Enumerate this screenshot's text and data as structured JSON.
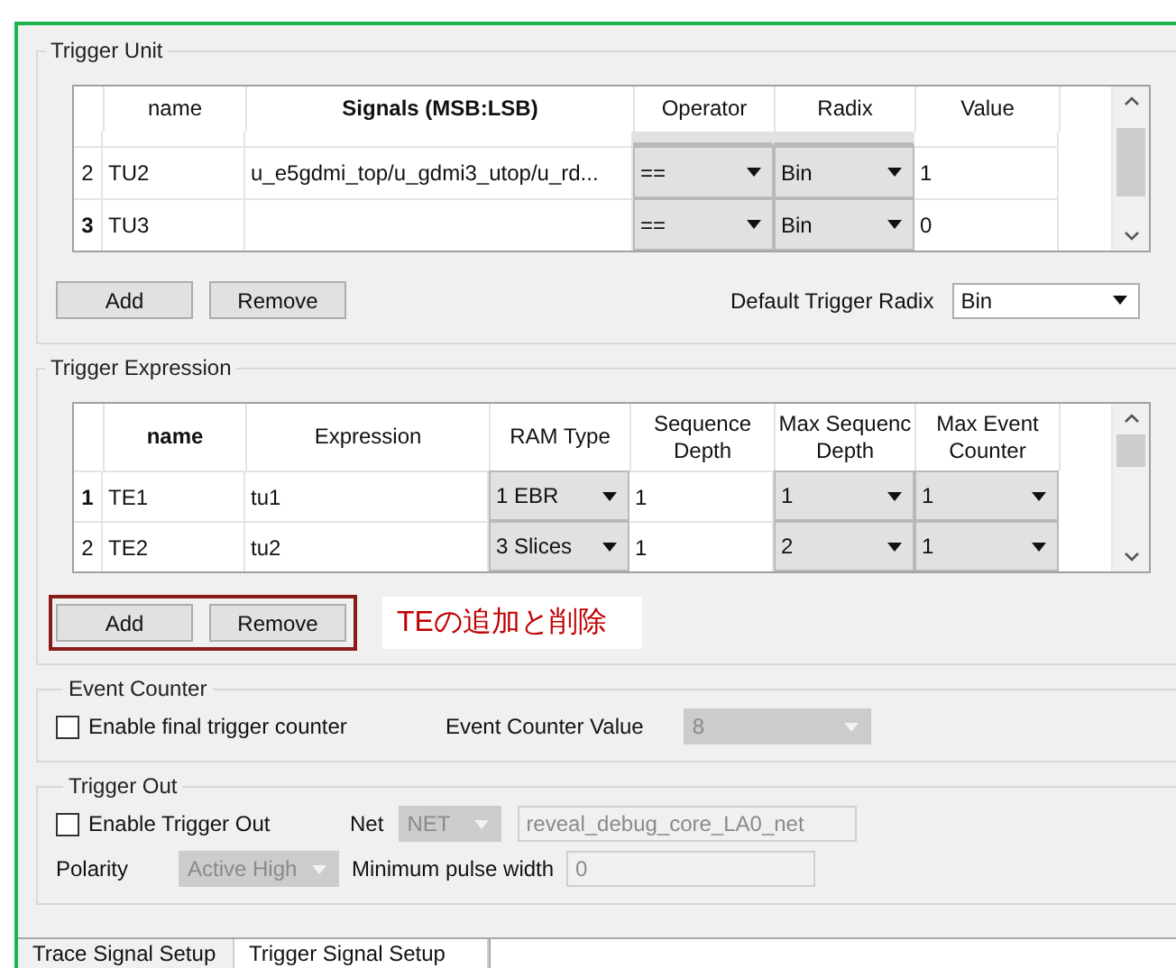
{
  "trigger_unit": {
    "title": "Trigger Unit",
    "table": {
      "columns": [
        {
          "label": "name",
          "bold": false
        },
        {
          "label": "Signals (MSB:LSB)",
          "bold": true
        },
        {
          "label": "Operator",
          "bold": false
        },
        {
          "label": "Radix",
          "bold": false
        },
        {
          "label": "Value",
          "bold": false
        }
      ],
      "rows": [
        {
          "number": "2",
          "selected": false,
          "cells": [
            {
              "kind": "text",
              "text": "TU2"
            },
            {
              "kind": "text",
              "text": "u_e5gdmi_top/u_gdmi3_utop/u_rd..."
            },
            {
              "kind": "select",
              "text": "=="
            },
            {
              "kind": "select",
              "text": "Bin"
            },
            {
              "kind": "text",
              "text": "1"
            }
          ]
        },
        {
          "number": "3",
          "selected": true,
          "cells": [
            {
              "kind": "text",
              "text": "TU3"
            },
            {
              "kind": "text",
              "text": ""
            },
            {
              "kind": "select",
              "text": "=="
            },
            {
              "kind": "select",
              "text": "Bin"
            },
            {
              "kind": "text",
              "text": "0"
            }
          ]
        }
      ]
    },
    "buttons": [
      "Add",
      "Remove"
    ],
    "default_radix": {
      "label": "Default Trigger Radix",
      "value": "Bin"
    }
  },
  "trigger_expression": {
    "title": "Trigger Expression",
    "table": {
      "columns": [
        {
          "label": "name",
          "bold": true
        },
        {
          "label": "Expression",
          "bold": false
        },
        {
          "label": "RAM Type",
          "bold": false
        },
        {
          "label": "Sequence Depth",
          "bold": false
        },
        {
          "label": "Max Sequenc Depth",
          "bold": false
        },
        {
          "label": "Max Event Counter",
          "bold": false
        }
      ],
      "rows": [
        {
          "number": "1",
          "selected": true,
          "cells": [
            {
              "kind": "text",
              "text": "TE1"
            },
            {
              "kind": "text",
              "text": "tu1"
            },
            {
              "kind": "select",
              "text": "1 EBR"
            },
            {
              "kind": "text",
              "text": "1"
            },
            {
              "kind": "select",
              "text": "1"
            },
            {
              "kind": "select",
              "text": "1"
            }
          ]
        },
        {
          "number": "2",
          "selected": false,
          "cells": [
            {
              "kind": "text",
              "text": "TE2"
            },
            {
              "kind": "text",
              "text": "tu2"
            },
            {
              "kind": "select",
              "text": "3 Slices"
            },
            {
              "kind": "text",
              "text": "1"
            },
            {
              "kind": "select",
              "text": "2"
            },
            {
              "kind": "select",
              "text": "1"
            }
          ]
        }
      ]
    },
    "buttons": [
      "Add",
      "Remove"
    ],
    "annotation": "TEの追加と削除"
  },
  "event_counter": {
    "title": "Event Counter",
    "enable": {
      "label": "Enable final trigger counter",
      "checked": false
    },
    "value": {
      "label": "Event Counter Value",
      "value": "8",
      "disabled": true
    }
  },
  "trigger_out": {
    "title": "Trigger Out",
    "enable": {
      "label": "Enable Trigger Out",
      "checked": false
    },
    "net": {
      "label": "Net",
      "value": "NET",
      "disabled": true
    },
    "net_name": {
      "value": "reveal_debug_core_LA0_net",
      "disabled": true
    },
    "polarity": {
      "label": "Polarity",
      "value": "Active High",
      "disabled": true
    },
    "min_pulse": {
      "label": "Minimum pulse width",
      "value": "0",
      "disabled": true
    }
  },
  "tabs": [
    {
      "label": "Trace Signal Setup",
      "selected": false
    },
    {
      "label": "Trigger Signal Setup",
      "selected": true
    }
  ]
}
